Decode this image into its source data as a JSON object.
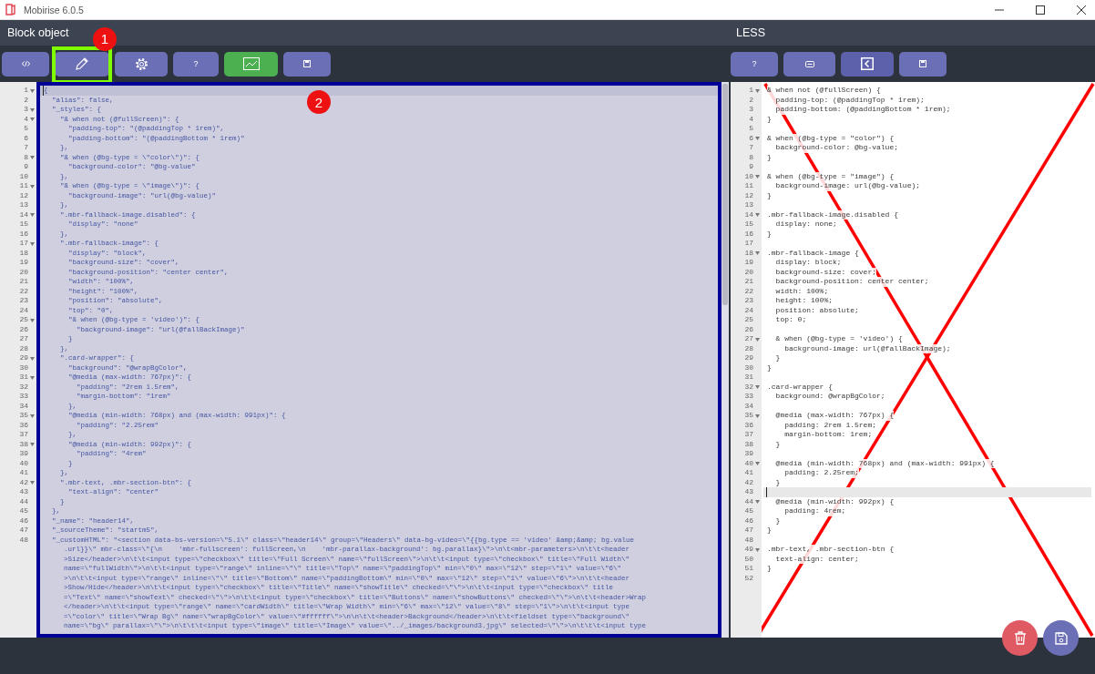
{
  "window": {
    "title": "Mobirise 6.0.5"
  },
  "left_panel": {
    "title": "Block object",
    "toolbar": [
      {
        "kind": "code",
        "color": "#6b6fb5"
      },
      {
        "kind": "edit",
        "color": "#6b6fb5",
        "annotation": "1"
      },
      {
        "kind": "settings",
        "color": "#6b6fb5"
      },
      {
        "kind": "help",
        "color": "#6b6fb5",
        "label": "?"
      },
      {
        "kind": "chart",
        "color": "#4caf50"
      },
      {
        "kind": "save",
        "color": "#6b6fb5"
      }
    ],
    "editor": {
      "selected_all": true,
      "annotation": "2",
      "lines": [
        {
          "n": "1",
          "text": "{",
          "fold": true,
          "active": true
        },
        {
          "n": "2",
          "text": "  \"alias\": false,",
          "fold": false,
          "active": false
        },
        {
          "n": "3",
          "text": "  \"_styles\": {",
          "fold": true,
          "active": false
        },
        {
          "n": "4",
          "text": "    \"& when not (@fullScreen)\": {",
          "fold": true,
          "active": false
        },
        {
          "n": "5",
          "text": "      \"padding-top\": \"(@paddingTop * 1rem)\",",
          "fold": false,
          "active": false
        },
        {
          "n": "6",
          "text": "      \"padding-bottom\": \"(@paddingBottom * 1rem)\"",
          "fold": false,
          "active": false
        },
        {
          "n": "7",
          "text": "    },",
          "fold": false,
          "active": false
        },
        {
          "n": "8",
          "text": "    \"& when (@bg-type = \\\"color\\\")\": {",
          "fold": true,
          "active": false
        },
        {
          "n": "9",
          "text": "      \"background-color\": \"@bg-value\"",
          "fold": false,
          "active": false
        },
        {
          "n": "10",
          "text": "    },",
          "fold": false,
          "active": false
        },
        {
          "n": "11",
          "text": "    \"& when (@bg-type = \\\"image\\\")\": {",
          "fold": true,
          "active": false
        },
        {
          "n": "12",
          "text": "      \"background-image\": \"url(@bg-value)\"",
          "fold": false,
          "active": false
        },
        {
          "n": "13",
          "text": "    },",
          "fold": false,
          "active": false
        },
        {
          "n": "14",
          "text": "    \".mbr-fallback-image.disabled\": {",
          "fold": true,
          "active": false
        },
        {
          "n": "15",
          "text": "      \"display\": \"none\"",
          "fold": false,
          "active": false
        },
        {
          "n": "16",
          "text": "    },",
          "fold": false,
          "active": false
        },
        {
          "n": "17",
          "text": "    \".mbr-fallback-image\": {",
          "fold": true,
          "active": false
        },
        {
          "n": "18",
          "text": "      \"display\": \"block\",",
          "fold": false,
          "active": false
        },
        {
          "n": "19",
          "text": "      \"background-size\": \"cover\",",
          "fold": false,
          "active": false
        },
        {
          "n": "20",
          "text": "      \"background-position\": \"center center\",",
          "fold": false,
          "active": false
        },
        {
          "n": "21",
          "text": "      \"width\": \"100%\",",
          "fold": false,
          "active": false
        },
        {
          "n": "22",
          "text": "      \"height\": \"100%\",",
          "fold": false,
          "active": false
        },
        {
          "n": "23",
          "text": "      \"position\": \"absolute\",",
          "fold": false,
          "active": false
        },
        {
          "n": "24",
          "text": "      \"top\": \"0\",",
          "fold": false,
          "active": false
        },
        {
          "n": "25",
          "text": "      \"& when (@bg-type = 'video')\": {",
          "fold": true,
          "active": false
        },
        {
          "n": "26",
          "text": "        \"background-image\": \"url(@fallBackImage)\"",
          "fold": false,
          "active": false
        },
        {
          "n": "27",
          "text": "      }",
          "fold": false,
          "active": false
        },
        {
          "n": "28",
          "text": "    },",
          "fold": false,
          "active": false
        },
        {
          "n": "29",
          "text": "    \".card-wrapper\": {",
          "fold": true,
          "active": false
        },
        {
          "n": "30",
          "text": "      \"background\": \"@wrapBgColor\",",
          "fold": false,
          "active": false
        },
        {
          "n": "31",
          "text": "      \"@media (max-width: 767px)\": {",
          "fold": true,
          "active": false
        },
        {
          "n": "32",
          "text": "        \"padding\": \"2rem 1.5rem\",",
          "fold": false,
          "active": false
        },
        {
          "n": "33",
          "text": "        \"margin-bottom\": \"1rem\"",
          "fold": false,
          "active": false
        },
        {
          "n": "34",
          "text": "      },",
          "fold": false,
          "active": false
        },
        {
          "n": "35",
          "text": "      \"@media (min-width: 768px) and (max-width: 991px)\": {",
          "fold": true,
          "active": false
        },
        {
          "n": "36",
          "text": "        \"padding\": \"2.25rem\"",
          "fold": false,
          "active": false
        },
        {
          "n": "37",
          "text": "      },",
          "fold": false,
          "active": false
        },
        {
          "n": "38",
          "text": "      \"@media (min-width: 992px)\": {",
          "fold": true,
          "active": false
        },
        {
          "n": "39",
          "text": "        \"padding\": \"4rem\"",
          "fold": false,
          "active": false
        },
        {
          "n": "40",
          "text": "      }",
          "fold": false,
          "active": false
        },
        {
          "n": "41",
          "text": "    },",
          "fold": false,
          "active": false
        },
        {
          "n": "42",
          "text": "    \".mbr-text, .mbr-section-btn\": {",
          "fold": true,
          "active": false
        },
        {
          "n": "43",
          "text": "      \"text-align\": \"center\"",
          "fold": false,
          "active": false
        },
        {
          "n": "44",
          "text": "    }",
          "fold": false,
          "active": false
        },
        {
          "n": "45",
          "text": "  },",
          "fold": false,
          "active": false
        },
        {
          "n": "46",
          "text": "  \"_name\": \"header14\",",
          "fold": false,
          "active": false
        },
        {
          "n": "47",
          "text": "  \"_sourceTheme\": \"startm5\",",
          "fold": false,
          "active": false
        },
        {
          "n": "48",
          "text": "  \"_customHTML\": \"<section data-bs-version=\\\"5.1\\\" class=\\\"header14\\\" group=\\\"Headers\\\" data-bg-video=\\\"{{bg.type == 'video' &amp;&amp; bg.value",
          "fold": false,
          "active": false,
          "wrapped": [
            ".url}}\\\" mbr-class=\\\"{\\n    'mbr-fullscreen': fullScreen,\\n    'mbr-parallax-background': bg.parallax}\\\">\\n\\t<mbr-parameters>\\n\\t\\t<header",
            ">Size</header>\\n\\t\\t<input type=\\\"checkbox\\\" title=\\\"Full Screen\\\" name=\\\"fullScreen\\\">\\n\\t\\t<input type=\\\"checkbox\\\" title=\\\"Full Width\\\"",
            "name=\\\"fullWidth\\\">\\n\\t\\t<input type=\\\"range\\\" inline=\\\"\\\" title=\\\"Top\\\" name=\\\"paddingTop\\\" min=\\\"0\\\" max=\\\"12\\\" step=\\\"1\\\" value=\\\"6\\\"",
            ">\\n\\t\\t<input type=\\\"range\\\" inline=\\\"\\\" title=\\\"Bottom\\\" name=\\\"paddingBottom\\\" min=\\\"0\\\" max=\\\"12\\\" step=\\\"1\\\" value=\\\"6\\\">\\n\\t\\t<header",
            ">Show/Hide</header>\\n\\t\\t<input type=\\\"checkbox\\\" title=\\\"Title\\\" name=\\\"showTitle\\\" checked=\\\"\\\">\\n\\t\\t<input type=\\\"checkbox\\\" title",
            "=\\\"Text\\\" name=\\\"showText\\\" checked=\\\"\\\">\\n\\t\\t<input type=\\\"checkbox\\\" title=\\\"Buttons\\\" name=\\\"showButtons\\\" checked=\\\"\\\">\\n\\t\\t<header>Wrap",
            "</header>\\n\\t\\t<input type=\\\"range\\\" name=\\\"cardWidth\\\" title=\\\"Wrap Width\\\" min=\\\"6\\\" max=\\\"12\\\" value=\\\"8\\\" step=\\\"1\\\">\\n\\t\\t<input type",
            "=\\\"color\\\" title=\\\"Wrap Bg\\\" name=\\\"wrapBgColor\\\" value=\\\"#ffffff\\\">\\n\\n\\t\\t<header>Background</header>\\n\\t\\t<fieldset type=\\\"background\\\"",
            "name=\\\"bg\\\" parallax=\\\"\\\">\\n\\t\\t\\t<input type=\\\"image\\\" title=\\\"Image\\\" value=\\\"../_images/background3.jpg\\\" selected=\\\"\\\">\\n\\t\\t\\t<input type"
          ]
        }
      ]
    }
  },
  "right_panel": {
    "title": "LESS",
    "crossed_out": true,
    "toolbar": [
      {
        "kind": "help",
        "color": "#6b6fb5",
        "label": "?"
      },
      {
        "kind": "keyboard",
        "color": "#6b6fb5"
      },
      {
        "kind": "back",
        "color": "#5d61ab"
      },
      {
        "kind": "save",
        "color": "#6b6fb5"
      }
    ],
    "editor": {
      "selected_all": false,
      "lines": [
        {
          "n": "1",
          "text": "& when not (@fullScreen) {",
          "fold": true,
          "active": false
        },
        {
          "n": "2",
          "text": "  padding-top: (@paddingTop * 1rem);",
          "fold": false,
          "active": false
        },
        {
          "n": "3",
          "text": "  padding-bottom: (@paddingBottom * 1rem);",
          "fold": false,
          "active": false
        },
        {
          "n": "4",
          "text": "}",
          "fold": false,
          "active": false
        },
        {
          "n": "5",
          "fold": false,
          "active": false
        },
        {
          "n": "6",
          "text": "& when (@bg-type = \"color\") {",
          "fold": true,
          "active": false
        },
        {
          "n": "7",
          "text": "  background-color: @bg-value;",
          "fold": false,
          "active": false
        },
        {
          "n": "8",
          "text": "}",
          "fold": false,
          "active": false
        },
        {
          "n": "9",
          "fold": false,
          "active": false
        },
        {
          "n": "10",
          "text": "& when (@bg-type = \"image\") {",
          "fold": true,
          "active": false
        },
        {
          "n": "11",
          "text": "  background-image: url(@bg-value);",
          "fold": false,
          "active": false
        },
        {
          "n": "12",
          "text": "}",
          "fold": false,
          "active": false
        },
        {
          "n": "13",
          "fold": false,
          "active": false
        },
        {
          "n": "14",
          "text": ".mbr-fallback-image.disabled {",
          "fold": true,
          "active": false
        },
        {
          "n": "15",
          "text": "  display: none;",
          "fold": false,
          "active": false
        },
        {
          "n": "16",
          "text": "}",
          "fold": false,
          "active": false
        },
        {
          "n": "17",
          "fold": false,
          "active": false
        },
        {
          "n": "18",
          "text": ".mbr-fallback-image {",
          "fold": true,
          "active": false
        },
        {
          "n": "19",
          "text": "  display: block;",
          "fold": false,
          "active": false
        },
        {
          "n": "20",
          "text": "  background-size: cover;",
          "fold": false,
          "active": false
        },
        {
          "n": "21",
          "text": "  background-position: center center;",
          "fold": false,
          "active": false
        },
        {
          "n": "22",
          "text": "  width: 100%;",
          "fold": false,
          "active": false
        },
        {
          "n": "23",
          "text": "  height: 100%;",
          "fold": false,
          "active": false
        },
        {
          "n": "24",
          "text": "  position: absolute;",
          "fold": false,
          "active": false
        },
        {
          "n": "25",
          "text": "  top: 0;",
          "fold": false,
          "active": false
        },
        {
          "n": "26",
          "fold": false,
          "active": false
        },
        {
          "n": "27",
          "text": "  & when (@bg-type = 'video') {",
          "fold": true,
          "active": false
        },
        {
          "n": "28",
          "text": "    background-image: url(@fallBackImage);",
          "fold": false,
          "active": false
        },
        {
          "n": "29",
          "text": "  }",
          "fold": false,
          "active": false
        },
        {
          "n": "30",
          "text": "}",
          "fold": false,
          "active": false
        },
        {
          "n": "31",
          "fold": false,
          "active": false
        },
        {
          "n": "32",
          "text": ".card-wrapper {",
          "fold": true,
          "active": false
        },
        {
          "n": "33",
          "text": "  background: @wrapBgColor;",
          "fold": false,
          "active": false
        },
        {
          "n": "34",
          "fold": false,
          "active": false
        },
        {
          "n": "35",
          "text": "  @media (max-width: 767px) {",
          "fold": true,
          "active": false
        },
        {
          "n": "36",
          "text": "    padding: 2rem 1.5rem;",
          "fold": false,
          "active": false
        },
        {
          "n": "37",
          "text": "    margin-bottom: 1rem;",
          "fold": false,
          "active": false
        },
        {
          "n": "38",
          "text": "  }",
          "fold": false,
          "active": false
        },
        {
          "n": "39",
          "fold": false,
          "active": false
        },
        {
          "n": "40",
          "text": "  @media (min-width: 768px) and (max-width: 991px) {",
          "fold": true,
          "active": false
        },
        {
          "n": "41",
          "text": "    padding: 2.25rem;",
          "fold": false,
          "active": false
        },
        {
          "n": "42",
          "text": "  }",
          "fold": false,
          "active": false
        },
        {
          "n": "43",
          "fold": false,
          "active": true
        },
        {
          "n": "44",
          "text": "  @media (min-width: 992px) {",
          "fold": true,
          "active": false
        },
        {
          "n": "45",
          "text": "    padding: 4rem;",
          "fold": false,
          "active": false
        },
        {
          "n": "46",
          "text": "  }",
          "fold": false,
          "active": false
        },
        {
          "n": "47",
          "text": "}",
          "fold": false,
          "active": false
        },
        {
          "n": "48",
          "fold": false,
          "active": false
        },
        {
          "n": "49",
          "text": ".mbr-text, .mbr-section-btn {",
          "fold": true,
          "active": false
        },
        {
          "n": "50",
          "text": "  text-align: center;",
          "fold": false,
          "active": false
        },
        {
          "n": "51",
          "text": "}",
          "fold": false,
          "active": false
        },
        {
          "n": "52",
          "fold": false,
          "active": false
        }
      ]
    }
  },
  "actions": [
    {
      "kind": "delete",
      "color": "#e05a64"
    },
    {
      "kind": "save",
      "color": "#6b6fb5"
    }
  ]
}
